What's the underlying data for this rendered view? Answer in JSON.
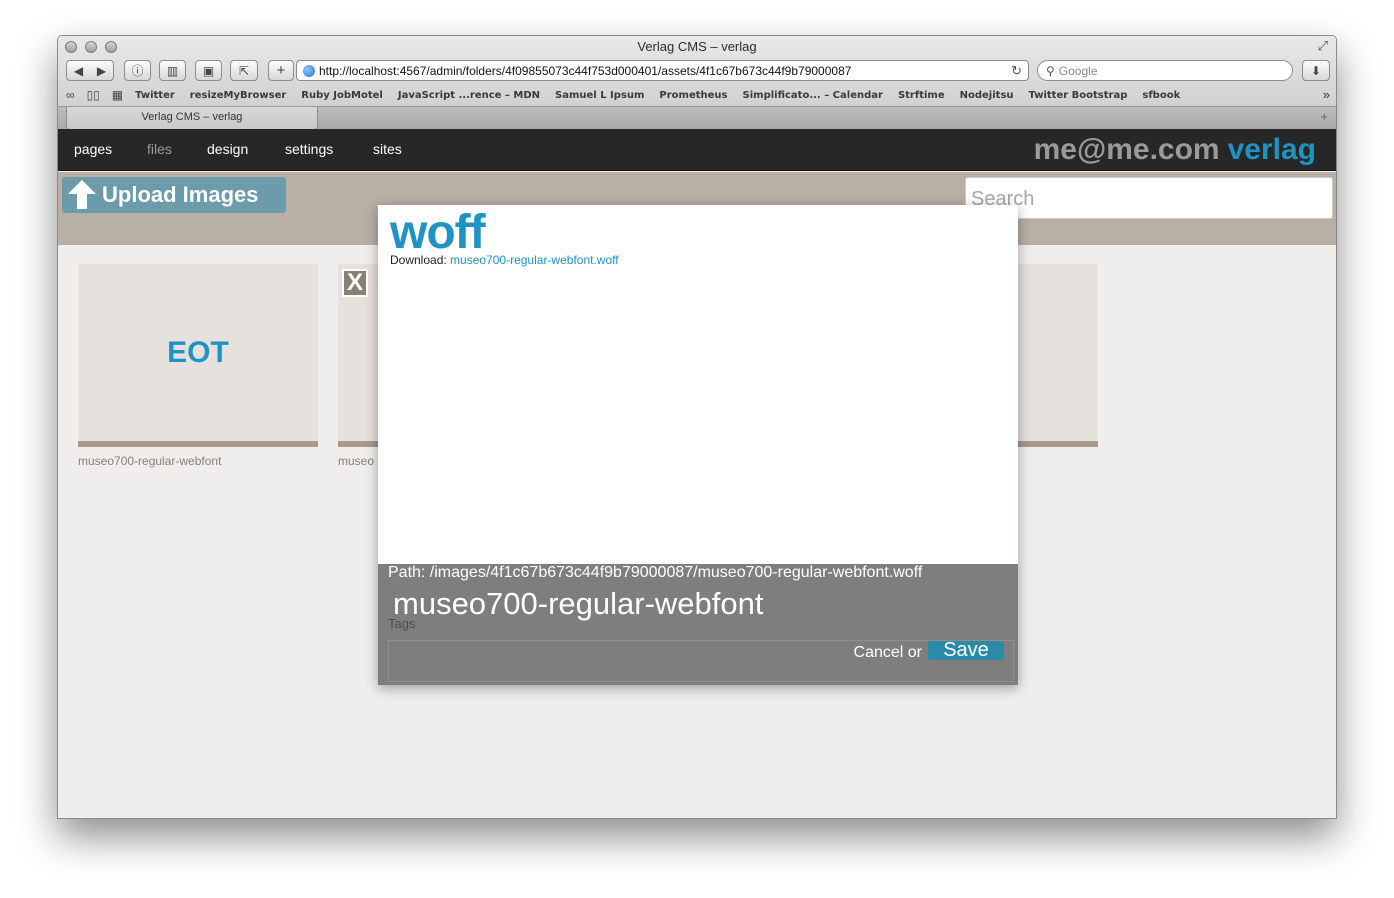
{
  "window": {
    "title": "Verlag CMS – verlag"
  },
  "toolbar": {
    "url": "http://localhost:4567/admin/folders/4f09855073c44f753d000401/assets/4f1c67b673c44f9b79000087",
    "search_placeholder": "Google",
    "new_tab_label": "+"
  },
  "bookmarks": [
    "Twitter",
    "resizeMyBrowser",
    "Ruby JobMotel",
    "JavaScript ...rence – MDN",
    "Samuel L Ipsum",
    "Prometheus",
    "Simplificato... – Calendar",
    "Strftime",
    "Nodejitsu",
    "Twitter Bootstrap",
    "sfbook"
  ],
  "tab": {
    "label": "Verlag CMS – verlag"
  },
  "nav": {
    "items": [
      "pages",
      "files",
      "design",
      "settings",
      "sites"
    ],
    "active": "files",
    "user": "me@me.com",
    "app_name": "verlag"
  },
  "actions": {
    "upload_label": "Upload Images",
    "search_placeholder": "Search"
  },
  "assets": [
    {
      "thumb_text": "EOT",
      "label": "museo700-regular-webfont"
    },
    {
      "thumb_text": "",
      "label": "museo"
    },
    {
      "thumb_text": "",
      "label": ""
    }
  ],
  "delete_label": "X",
  "modal": {
    "title": "woff",
    "download_label": "Download:",
    "download_link": "museo700-regular-webfont.woff",
    "path": "Path: /images/4f1c67b673c44f9b79000087/museo700-regular-webfont.woff",
    "name_value": "museo700-regular-webfont",
    "tags_label": "Tags",
    "tags_value": "",
    "cancel_label": "Cancel or",
    "save_label": "Save"
  }
}
